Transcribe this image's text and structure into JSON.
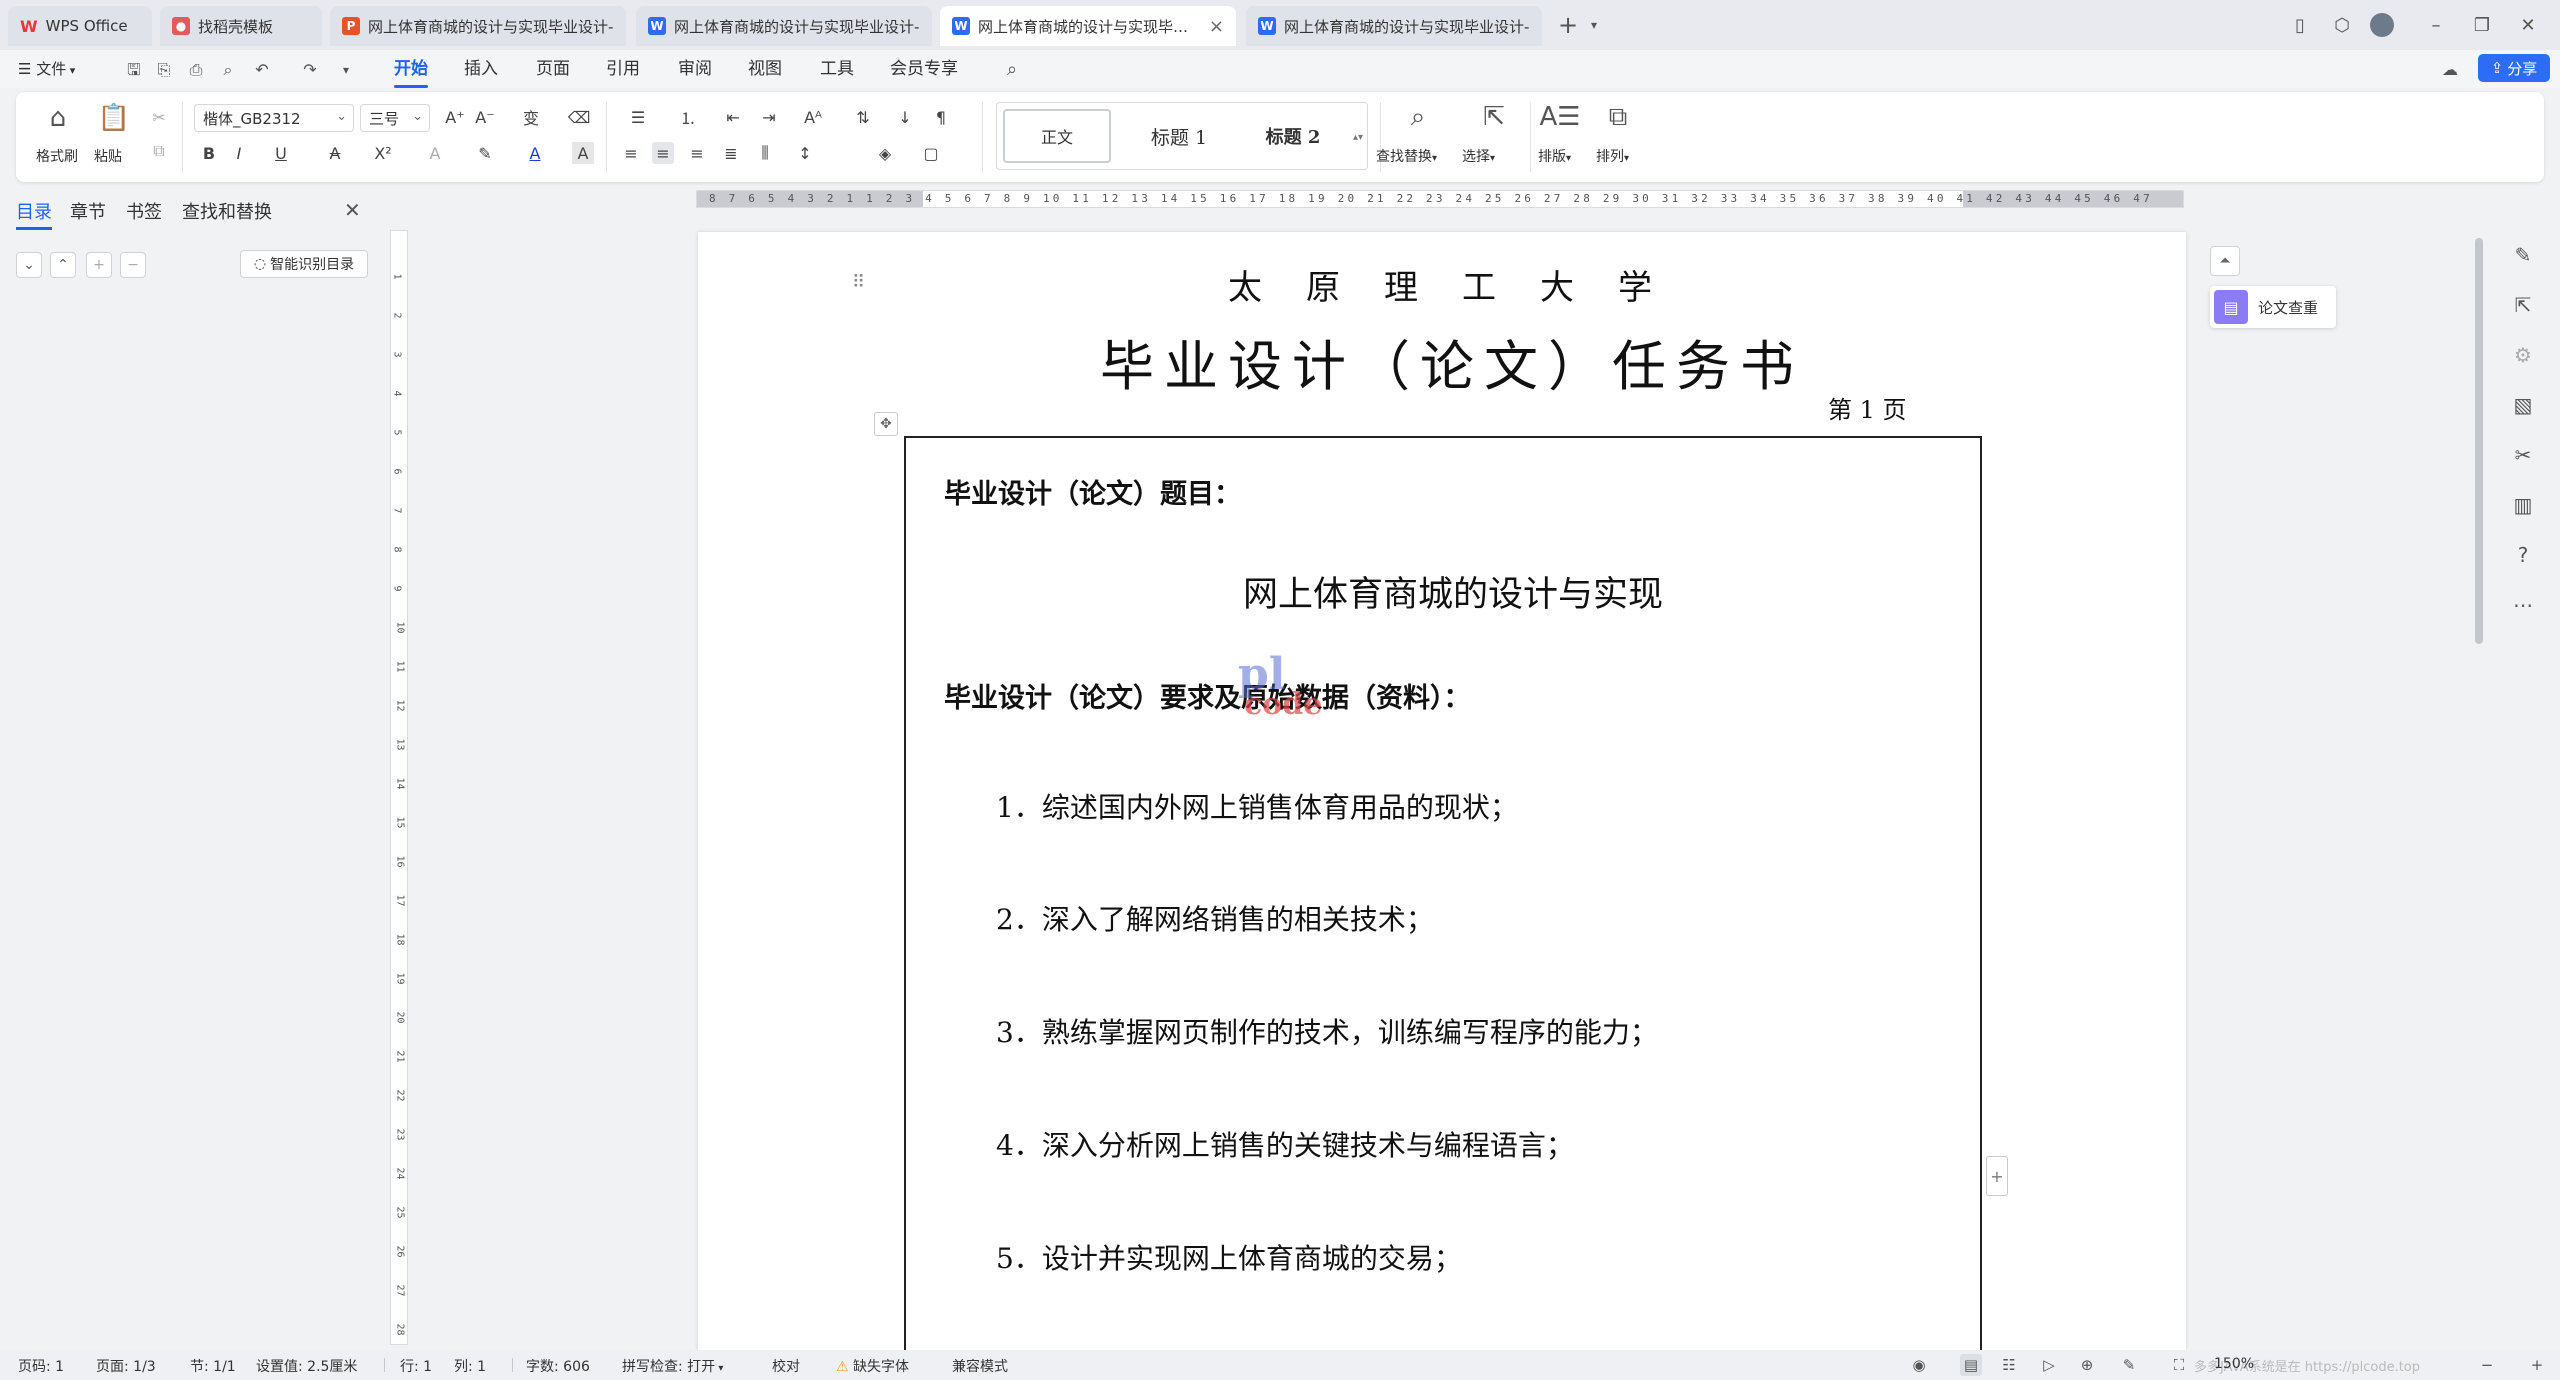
{
  "tabs": [
    {
      "label": "WPS Office",
      "type": "home"
    },
    {
      "label": "找稻壳模板",
      "type": "template",
      "icon_color": "#e45a5a"
    },
    {
      "label": "网上体育商城的设计与实现毕业设计-",
      "type": "ppt",
      "icon_color": "#e5532d",
      "icon_letter": "P"
    },
    {
      "label": "网上体育商城的设计与实现毕业设计-",
      "type": "doc",
      "icon_color": "#2f6bf0",
      "icon_letter": "W"
    },
    {
      "label": "网上体育商城的设计与实现毕业设计",
      "type": "doc",
      "icon_color": "#2f6bf0",
      "icon_letter": "W",
      "active": true,
      "close": "×"
    },
    {
      "label": "网上体育商城的设计与实现毕业设计-",
      "type": "doc",
      "icon_color": "#2f6bf0",
      "icon_letter": "W"
    }
  ],
  "menu": {
    "file": "文件",
    "items": [
      "开始",
      "插入",
      "页面",
      "引用",
      "审阅",
      "视图",
      "工具",
      "会员专享"
    ],
    "active": "开始",
    "share": "分享"
  },
  "ribbon": {
    "format_painter": "格式刷",
    "paste": "粘贴",
    "font_name": "楷体_GB2312",
    "font_size": "三号",
    "styles": [
      "正文",
      "标题 1",
      "标题 2"
    ],
    "find_replace": "查找替换",
    "select": "选择",
    "layout": "排版",
    "arrange": "排列"
  },
  "nav": {
    "tabs": [
      "目录",
      "章节",
      "书签",
      "查找和替换"
    ],
    "active": "目录",
    "smart_toc": "智能识别目录"
  },
  "hruler_text": "8 7 6 5 4 3 2 1   1 2 3 4 5 6 7 8 9 10 11 12 13 14 15 16 17 18 19 20 21 22 23 24 25 26 27 28 29 30 31 32 33 34 35 36 37 38 39 40 41 42 43 44 45 46 47",
  "vruler_numbers": [
    "1",
    "2",
    "3",
    "4",
    "5",
    "6",
    "7",
    "8",
    "9",
    "10",
    "11",
    "12",
    "13",
    "14",
    "15",
    "16",
    "17",
    "18",
    "19",
    "20",
    "21",
    "22",
    "23",
    "24",
    "25",
    "26",
    "27",
    "28"
  ],
  "document": {
    "university": "太原理工大学",
    "title": "毕业设计（论文）任务书",
    "page_label": "第 1 页",
    "topic_label": "毕业设计（论文）题目：",
    "topic": "网上体育商城的设计与实现",
    "requirements_label": "毕业设计（论文）要求及原始数据（资料）：",
    "requirements": [
      "1．综述国内外网上销售体育用品的现状；",
      "2．深入了解网络销售的相关技术；",
      "3．熟练掌握网页制作的技术，训练编写程序的能力；",
      "4．深入分析网上销售的关键技术与编程语言；",
      "5．设计并实现网上体育商城的交易；"
    ],
    "watermark_top": "pl",
    "watermark_bottom": "code"
  },
  "side_float": {
    "paper_check": "论文查重"
  },
  "status": {
    "page_no": "页码: 1",
    "pages": "页面: 1/3",
    "section": "节: 1/1",
    "setting": "设置值: 2.5厘米",
    "row": "行: 1",
    "col": "列: 1",
    "words": "字数: 606",
    "spell": "拼写检查: 打开",
    "proof": "校对",
    "missing_font": "缺失字体",
    "compat": "兼容模式",
    "zoom": "150%",
    "watermark_text": "多多JAVA系统是在 https://plcode.top"
  }
}
